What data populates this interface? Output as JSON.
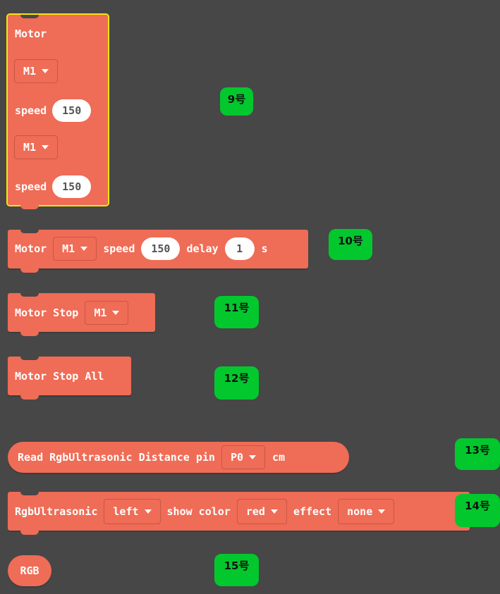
{
  "blocks": {
    "motor_dual": {
      "title": "Motor",
      "motor1": "M1",
      "speed1_label": "speed",
      "speed1": "150",
      "motor2": "M1",
      "speed2_label": "speed",
      "speed2": "150"
    },
    "motor_delay": {
      "label": "Motor",
      "motor": "M1",
      "speed_label": "speed",
      "speed": "150",
      "delay_label": "delay",
      "delay": "1",
      "unit": "s"
    },
    "motor_stop": {
      "label": "Motor Stop",
      "motor": "M1"
    },
    "motor_stop_all": {
      "label": "Motor Stop All"
    },
    "read_distance": {
      "label": "Read RgbUltrasonic Distance pin",
      "pin": "P0",
      "unit": "cm"
    },
    "rgb_ultrasonic": {
      "label": "RgbUltrasonic",
      "side": "left",
      "show_label": "show color",
      "color": "red",
      "effect_label": "effect",
      "effect": "none"
    },
    "rgb": {
      "label": "RGB"
    }
  },
  "badges": [
    "9号",
    "10号",
    "11号",
    "12号",
    "13号",
    "14号",
    "15号"
  ],
  "colors": {
    "block": "#ef6c56",
    "badge": "#02c82e",
    "background": "#474747",
    "selection": "#f5e60f"
  }
}
